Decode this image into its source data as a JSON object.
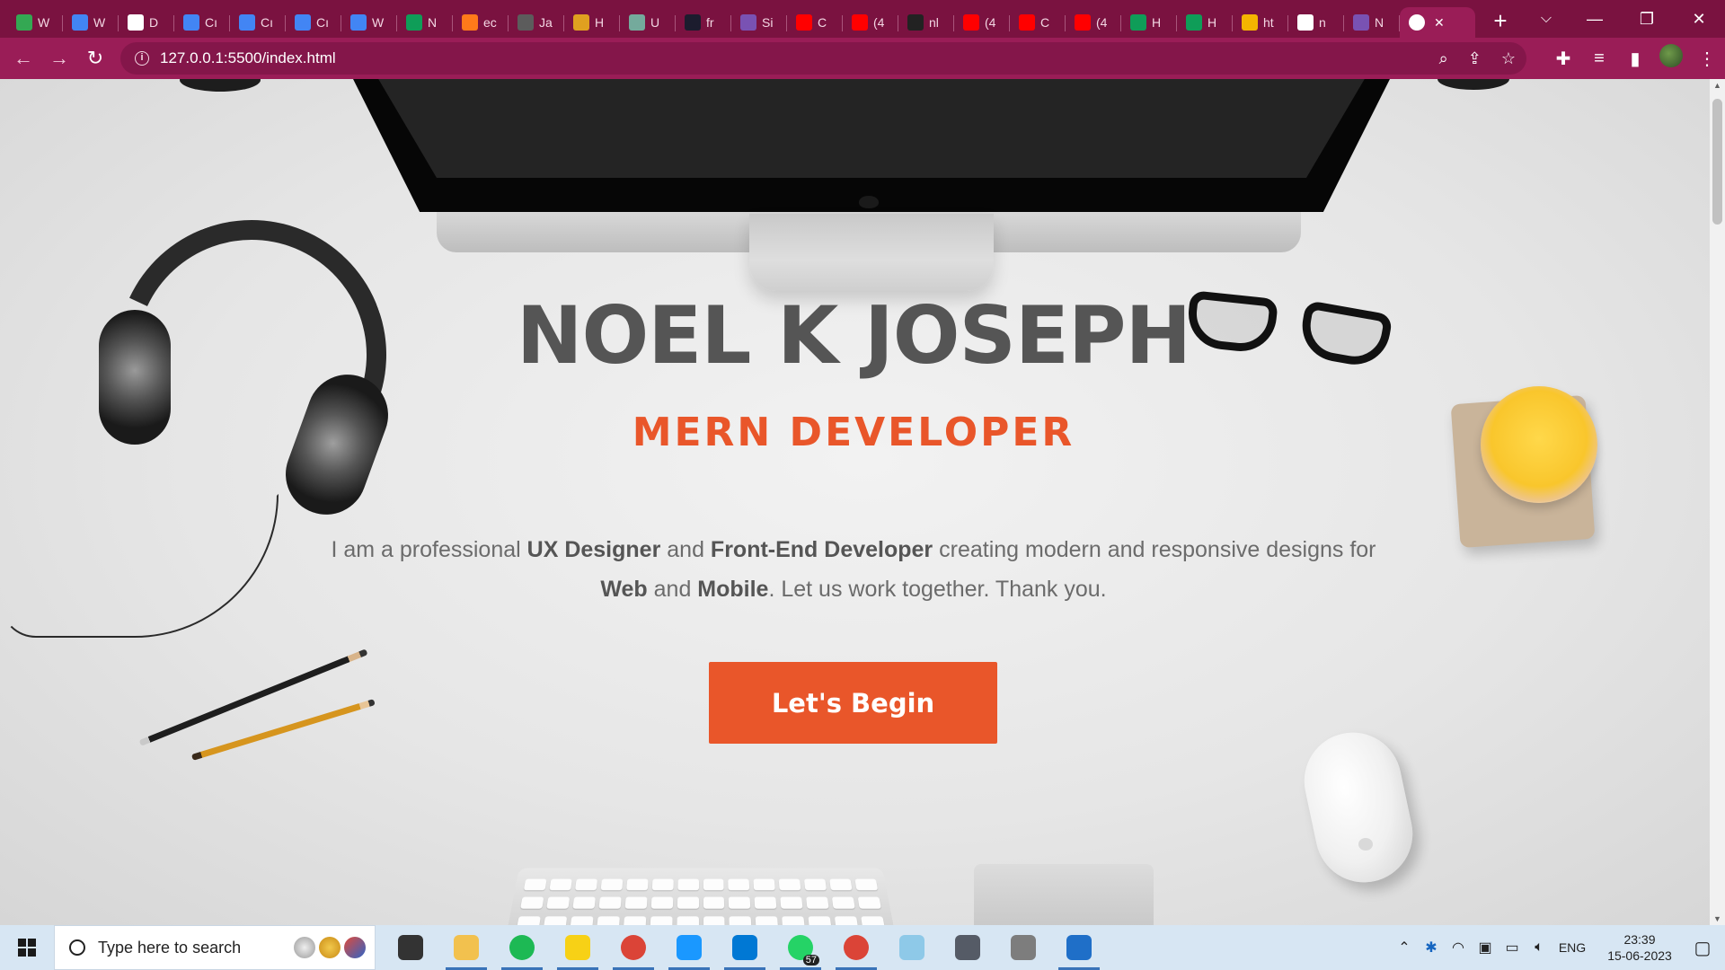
{
  "browser": {
    "tabs": [
      {
        "label": "W",
        "icon": "google-drive-icon",
        "color": "#34a853"
      },
      {
        "label": "W",
        "icon": "google-docs-icon",
        "color": "#4285f4"
      },
      {
        "label": "D",
        "icon": "google-icon",
        "color": "#ffffff"
      },
      {
        "label": "Cı",
        "icon": "google-docs-icon",
        "color": "#4285f4"
      },
      {
        "label": "Cı",
        "icon": "google-docs-icon",
        "color": "#4285f4"
      },
      {
        "label": "Cı",
        "icon": "google-docs-icon",
        "color": "#4285f4"
      },
      {
        "label": "W",
        "icon": "google-docs-icon",
        "color": "#4285f4"
      },
      {
        "label": "N",
        "icon": "google-sheets-icon",
        "color": "#0f9d58"
      },
      {
        "label": "ec",
        "icon": "flame-icon",
        "color": "#ff7a1a"
      },
      {
        "label": "Ja",
        "icon": "page-icon",
        "color": "#5c5c5c"
      },
      {
        "label": "H",
        "icon": "bolt-icon",
        "color": "#e0a020"
      },
      {
        "label": "U",
        "icon": "chatgpt-icon",
        "color": "#74aa9c"
      },
      {
        "label": "fr",
        "icon": "lambda-icon",
        "color": "#1c1c2e"
      },
      {
        "label": "Si",
        "icon": "bootstrap-icon",
        "color": "#7952b3"
      },
      {
        "label": "C",
        "icon": "youtube-icon",
        "color": "#ff0000"
      },
      {
        "label": "(4",
        "icon": "youtube-icon",
        "color": "#ff0000"
      },
      {
        "label": "nl",
        "icon": "github-icon",
        "color": "#222222"
      },
      {
        "label": "(4",
        "icon": "youtube-icon",
        "color": "#ff0000"
      },
      {
        "label": "C",
        "icon": "youtube-icon",
        "color": "#ff0000"
      },
      {
        "label": "(4",
        "icon": "youtube-icon",
        "color": "#ff0000"
      },
      {
        "label": "H",
        "icon": "google-sheets-icon",
        "color": "#0f9d58"
      },
      {
        "label": "H",
        "icon": "google-sheets-icon",
        "color": "#0f9d58"
      },
      {
        "label": "ht",
        "icon": "colorful-icon",
        "color": "#f4b400"
      },
      {
        "label": "n",
        "icon": "globe-icon",
        "color": "#ffffff"
      },
      {
        "label": "N",
        "icon": "bootstrap-icon",
        "color": "#7952b3"
      }
    ],
    "active_tab_icon": "globe-icon",
    "new_tab": "+",
    "url": "127.0.0.1:5500/index.html",
    "info_glyph": "i"
  },
  "hero": {
    "name": "NOEL K JOSEPH",
    "role": "MERN DEVELOPER",
    "desc_1": "I am a professional ",
    "desc_b1": "UX Designer",
    "desc_2": " and ",
    "desc_b2": "Front-End Developer",
    "desc_3": " creating modern and responsive designs for ",
    "desc_b3": "Web",
    "desc_4": " and ",
    "desc_b4": "Mobile",
    "desc_5": ". Let us work together. Thank you.",
    "cta_label": "Let's Begin",
    "accent_color": "#e9562a"
  },
  "taskbar": {
    "search_placeholder": "Type here to search",
    "apps": [
      {
        "name": "task-view-icon",
        "color": "#333333",
        "running": false
      },
      {
        "name": "file-explorer-icon",
        "color": "#f2c14e",
        "running": true
      },
      {
        "name": "spotify-icon",
        "color": "#1db954",
        "running": true
      },
      {
        "name": "sticky-notes-icon",
        "color": "#f7d116",
        "running": true
      },
      {
        "name": "chrome-icon",
        "color": "#db4437",
        "running": true
      },
      {
        "name": "prime-video-icon",
        "color": "#1a98ff",
        "running": true
      },
      {
        "name": "vscode-icon",
        "color": "#0078d4",
        "running": true
      },
      {
        "name": "whatsapp-icon",
        "color": "#25d366",
        "running": true
      },
      {
        "name": "chrome-profile-icon",
        "color": "#db4437",
        "running": true
      },
      {
        "name": "notepad-icon",
        "color": "#8ec9e8",
        "running": false
      },
      {
        "name": "camera-icon",
        "color": "#555b66",
        "running": false
      },
      {
        "name": "voice-recorder-icon",
        "color": "#7d7d7d",
        "running": false
      },
      {
        "name": "photos-icon",
        "color": "#1f6fc8",
        "running": true
      }
    ],
    "whatsapp_badge": "57",
    "language": "ENG",
    "time": "23:39",
    "date": "15-06-2023"
  }
}
